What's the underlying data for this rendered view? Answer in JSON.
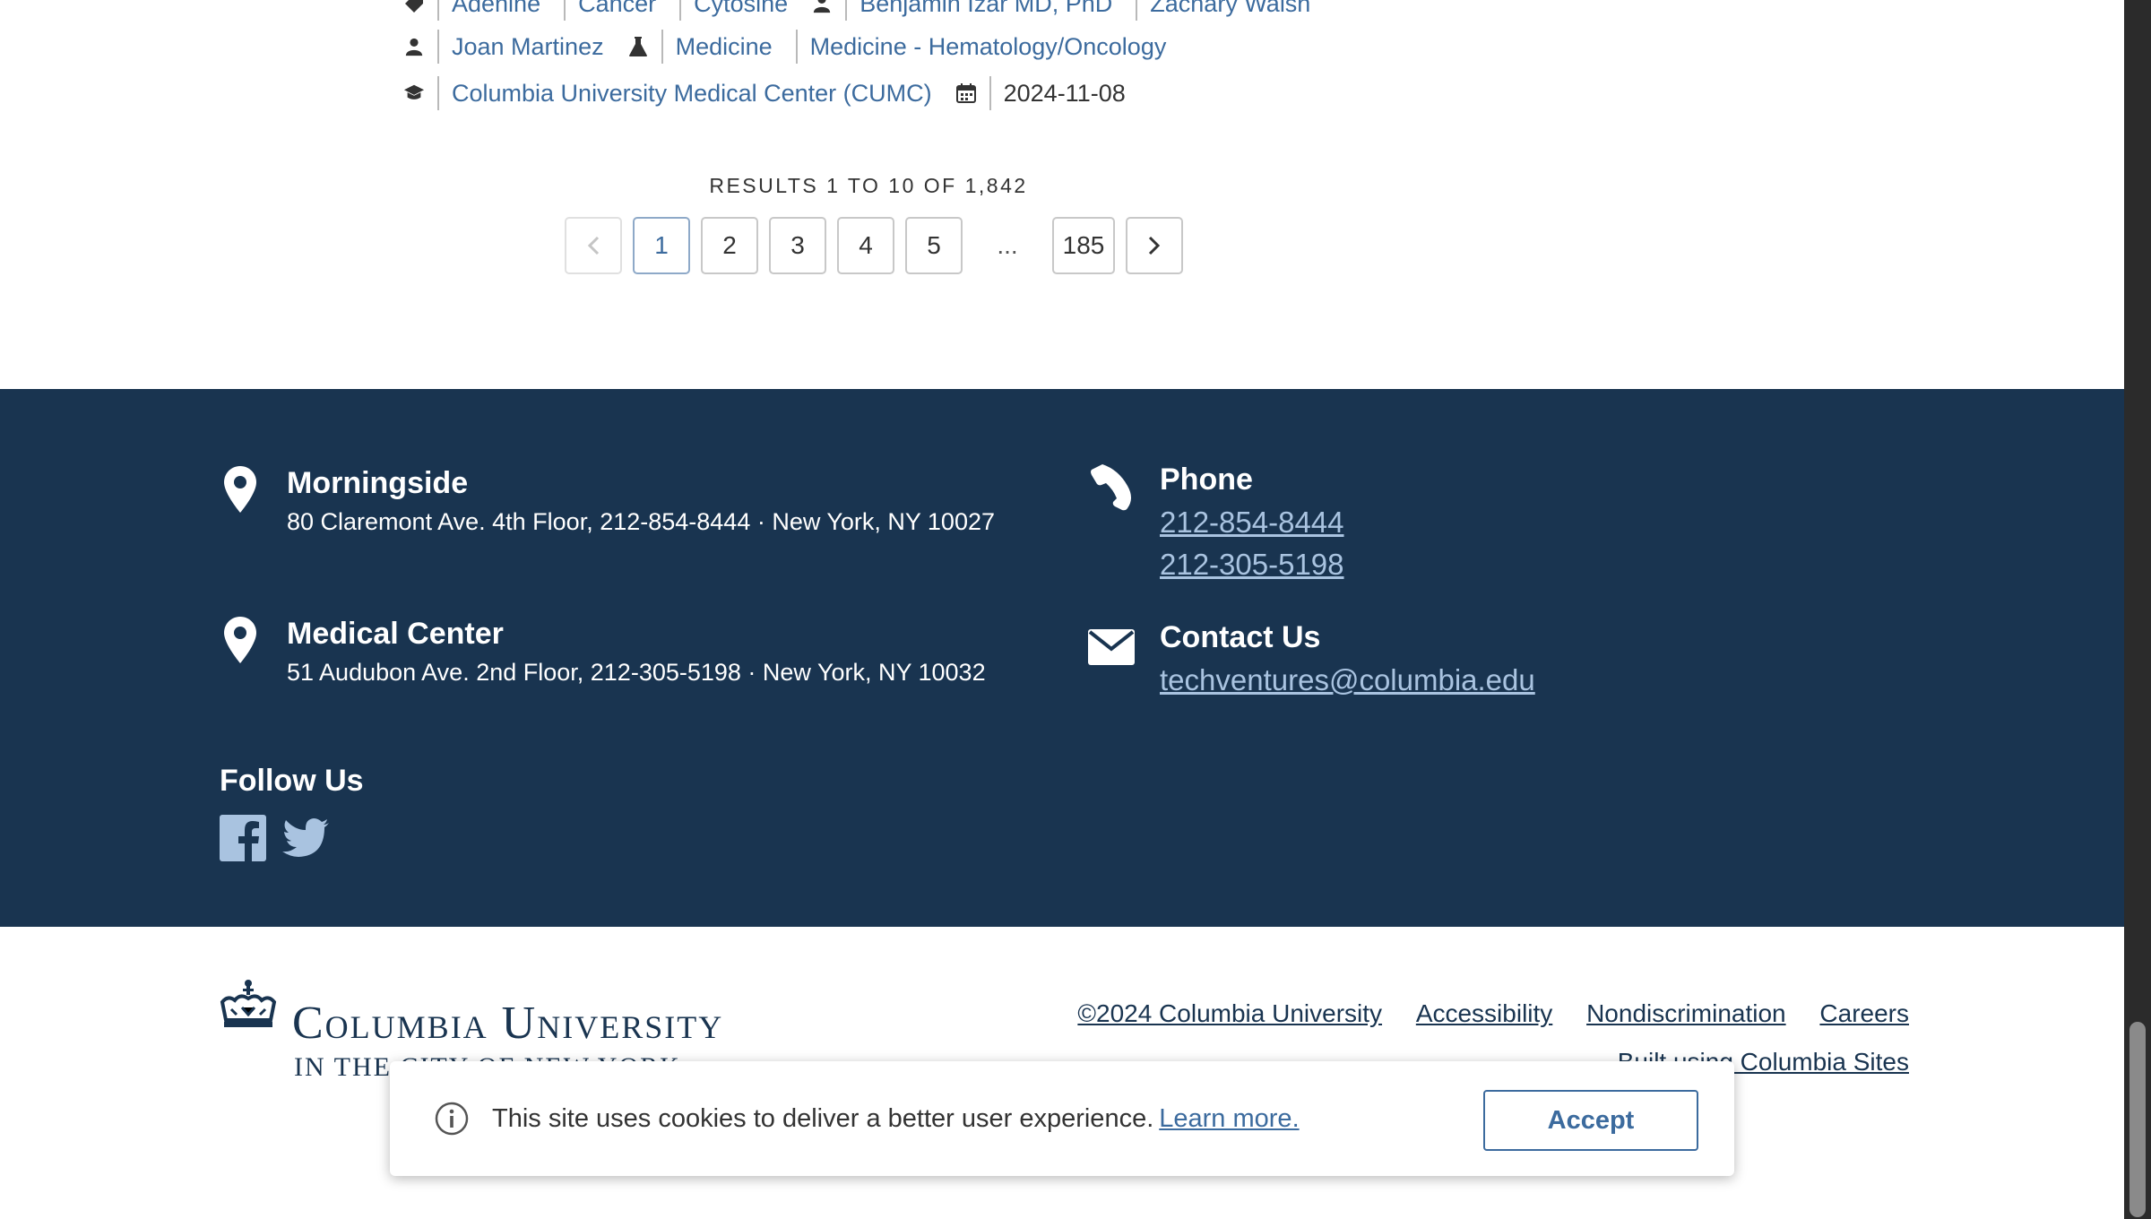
{
  "result_meta": {
    "row0": {
      "tags": [
        "Adenine",
        "Cancer",
        "Cytosine"
      ],
      "people": [
        "Benjamin Izar MD, PhD",
        "Zachary Walsh"
      ]
    },
    "row1": {
      "person": "Joan Martinez",
      "departments": [
        "Medicine",
        "Medicine - Hematology/Oncology"
      ]
    },
    "row2": {
      "school": "Columbia University Medical Center (CUMC)",
      "date": "2024-11-08"
    }
  },
  "pagination": {
    "summary": "RESULTS 1 TO 10 OF 1,842",
    "prev_icon": "chevron-left-icon",
    "next_icon": "chevron-right-icon",
    "pages": [
      "1",
      "2",
      "3",
      "4",
      "5"
    ],
    "ellipsis": "...",
    "last_page": "185",
    "current_page": "1"
  },
  "footer": {
    "locations": [
      {
        "name": "Morningside",
        "address": "80 Claremont Ave. 4th Floor, 212-854-8444 · New York, NY 10027"
      },
      {
        "name": "Medical Center",
        "address": "51 Audubon Ave. 2nd Floor, 212-305-5198 · New York, NY 10032"
      }
    ],
    "phone": {
      "heading": "Phone",
      "numbers": [
        "212-854-8444",
        "212-305-5198"
      ]
    },
    "contact": {
      "heading": "Contact Us",
      "email": "techventures@columbia.edu"
    },
    "follow": {
      "heading": "Follow Us",
      "networks": [
        "facebook-icon",
        "twitter-icon"
      ]
    },
    "bg_color": "#193450",
    "link_color": "#a9c3e0"
  },
  "bottom": {
    "logo_name": "Columbia University",
    "logo_sub": "IN THE CITY OF NEW YORK",
    "links": [
      "©2024 Columbia University",
      "Accessibility",
      "Nondiscrimination",
      "Careers",
      "Built using Columbia Sites"
    ]
  },
  "cookie": {
    "message": "This site uses cookies to deliver a better user experience.",
    "learn_more": "Learn more.",
    "accept": "Accept"
  },
  "colors": {
    "accent": "#3c6b9e",
    "navy": "#193450"
  }
}
